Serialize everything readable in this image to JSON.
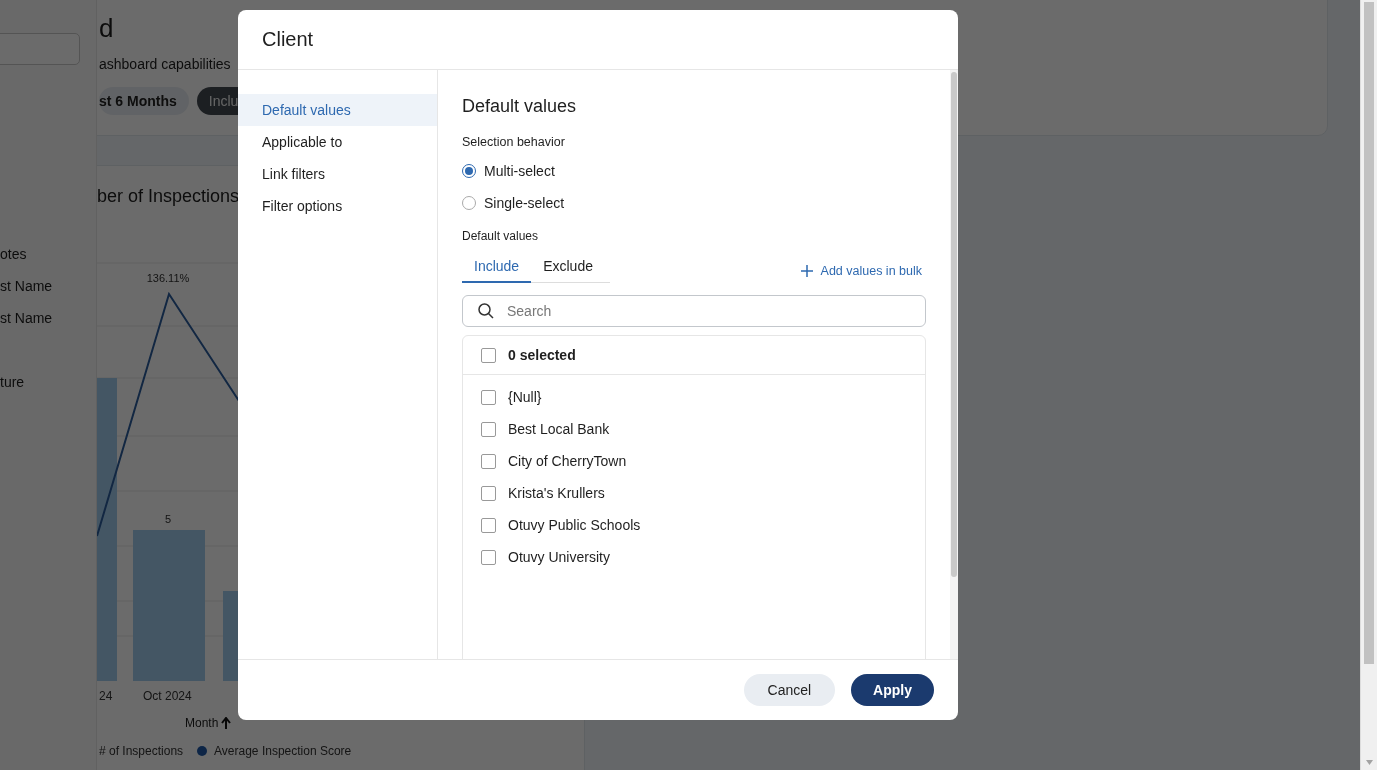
{
  "background": {
    "sidebar": {
      "items": [
        "otes",
        "st Name",
        "st Name",
        "ture"
      ]
    },
    "header": {
      "title": "d",
      "subtitle": "ashboard capabilities",
      "chips": [
        {
          "label": "st 6 Months",
          "selected": false
        },
        {
          "label": "Inclu",
          "selected": true
        }
      ]
    },
    "chart_card": {
      "title": "ber of Inspections",
      "line_label": "136.11%",
      "bar_label": "5",
      "x_labels": [
        "24",
        "Oct 2024"
      ],
      "x_axis_title": "Month",
      "legend": [
        {
          "label": "# of Inspections",
          "marker": false
        },
        {
          "label": "Average Inspection Score",
          "marker": true
        }
      ]
    }
  },
  "dialog": {
    "title": "Client",
    "nav": [
      {
        "label": "Default values",
        "selected": true
      },
      {
        "label": "Applicable to",
        "selected": false
      },
      {
        "label": "Link filters",
        "selected": false
      },
      {
        "label": "Filter options",
        "selected": false
      }
    ],
    "section_title": "Default values",
    "selection_behavior": {
      "label": "Selection behavior",
      "options": [
        {
          "label": "Multi-select",
          "selected": true
        },
        {
          "label": "Single-select",
          "selected": false
        }
      ]
    },
    "default_values": {
      "label": "Default values",
      "tabs": [
        {
          "label": "Include",
          "selected": true
        },
        {
          "label": "Exclude",
          "selected": false
        }
      ],
      "bulk_link": "Add values in bulk",
      "search": {
        "placeholder": "Search"
      },
      "select_all": {
        "label": "0 selected",
        "checked": false
      },
      "values": [
        {
          "label": "{Null}",
          "checked": false
        },
        {
          "label": "Best Local Bank",
          "checked": false
        },
        {
          "label": "City of CherryTown",
          "checked": false
        },
        {
          "label": "Krista's Krullers",
          "checked": false
        },
        {
          "label": "Otuvy Public Schools",
          "checked": false
        },
        {
          "label": "Otuvy University",
          "checked": false
        }
      ]
    },
    "buttons": [
      {
        "label": "Cancel",
        "kind": "secondary"
      },
      {
        "label": "Apply",
        "kind": "primary"
      }
    ]
  }
}
